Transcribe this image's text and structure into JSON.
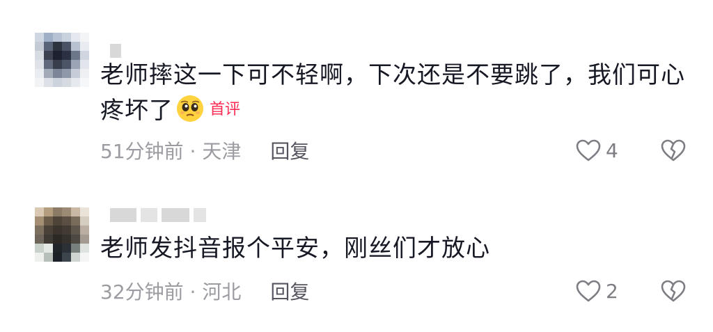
{
  "comments": [
    {
      "text": "老师摔这一下可不轻啊，下次还是不要跳了，我们可心疼坏了",
      "badge": "首评",
      "time": "51分钟前 · 天津",
      "reply": "回复",
      "likes": "4",
      "emoji": "pleading-face"
    },
    {
      "text": "老师发抖音报个平安，刚丝们才放心",
      "time": "32分钟前 · 河北",
      "reply": "回复",
      "likes": "2"
    }
  ],
  "icons": {
    "like": "heart-outline-icon",
    "dislike": "broken-heart-icon"
  },
  "colors": {
    "badge": "#fe2c55",
    "meta": "#9b9ba1",
    "text": "#161823"
  }
}
